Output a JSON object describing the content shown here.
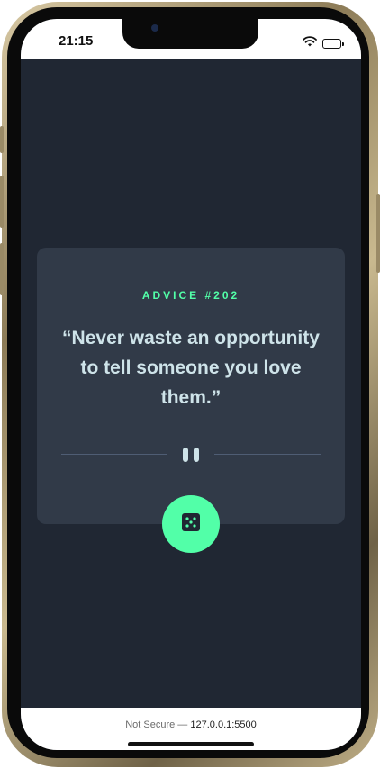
{
  "status_bar": {
    "time": "21:15",
    "icons": [
      "wifi-icon",
      "battery-icon"
    ]
  },
  "advice": {
    "id_label": "ADVICE #202",
    "text": "“Never waste an opportunity to tell someone you love them.”"
  },
  "dice_button": {
    "icon": "dice-icon"
  },
  "browser": {
    "security_label": "Not Secure —",
    "host": "127.0.0.1:5500"
  },
  "colors": {
    "accent": "#52ffa8",
    "background": "#202733",
    "card": "#313a48",
    "text": "#cee3e9"
  }
}
